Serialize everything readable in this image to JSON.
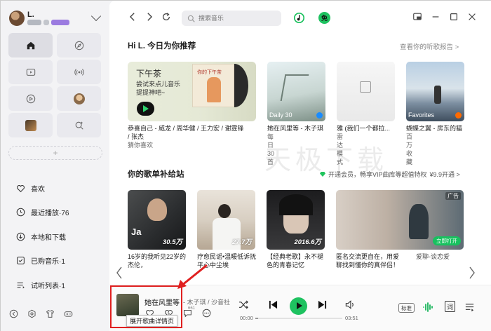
{
  "user": {
    "name": "L."
  },
  "search": {
    "placeholder": "搜索音乐"
  },
  "topbar": {
    "vip_label": "免"
  },
  "recommend": {
    "title": "Hi L. 今日为你推荐",
    "report_link": "查看你的听歌报告 >",
    "banner": {
      "title": "下午茶",
      "subtitle": "尝试来点儿音乐提提神吧~",
      "cover_text": "你的下午茶",
      "caption": "恭喜自己 - 威龙 / 周华健 / 王力宏 / 谢霆锋 / 张杰",
      "meta": "猜你喜欢"
    },
    "cards": [
      {
        "caption": "她在风里等 - 木子琪",
        "meta": "每日30首",
        "tag": "Daily 30"
      },
      {
        "caption": "雅 (我们一个都拉...",
        "meta": "雷达模式",
        "tag": ""
      },
      {
        "caption": "蝴蝶之翼 - 房东的猫",
        "meta": "百万收藏",
        "tag": "Favorites"
      }
    ]
  },
  "playlists": {
    "title": "你的歌单补给站",
    "vip_link": "开通会员，畅享VIP曲库等超值特权",
    "vip_price": "¥9.9开通 >",
    "cards": [
      {
        "caption": "16岁的我听见22岁的杰伦，",
        "caption2": "",
        "plays": "30.5万"
      },
      {
        "caption": "疗愈民谣•温暖低诉抚平心中尘埃",
        "caption2": "",
        "plays": "27.7万"
      },
      {
        "caption": "【经典老歌】永不褪色的青春记忆",
        "caption2": "",
        "plays": "2016.6万"
      },
      {
        "caption": "匿名交流更自在，用爱聊找到懂你的真伴侣！",
        "caption2": "",
        "ad": "广告",
        "open": "立即打开"
      },
      {
        "caption": "爱聊-谈恋爱",
        "caption2": ""
      }
    ]
  },
  "sidebar": {
    "nav": [
      {
        "label": "喜欢"
      },
      {
        "label": "最近播放·76"
      },
      {
        "label": "本地和下载"
      },
      {
        "label": "已购音乐·1"
      },
      {
        "label": "试听列表·1"
      }
    ]
  },
  "player": {
    "title": "她在风里等",
    "artist": "- 木子琪 / 沙音社",
    "comment_count": "661",
    "tooltip": "展开歌曲详情页",
    "time_current": "00:00",
    "time_total": "03:51",
    "progress": 0.03,
    "quality": "标准",
    "lyrics_label": "词"
  },
  "watermark": "天极下载"
}
